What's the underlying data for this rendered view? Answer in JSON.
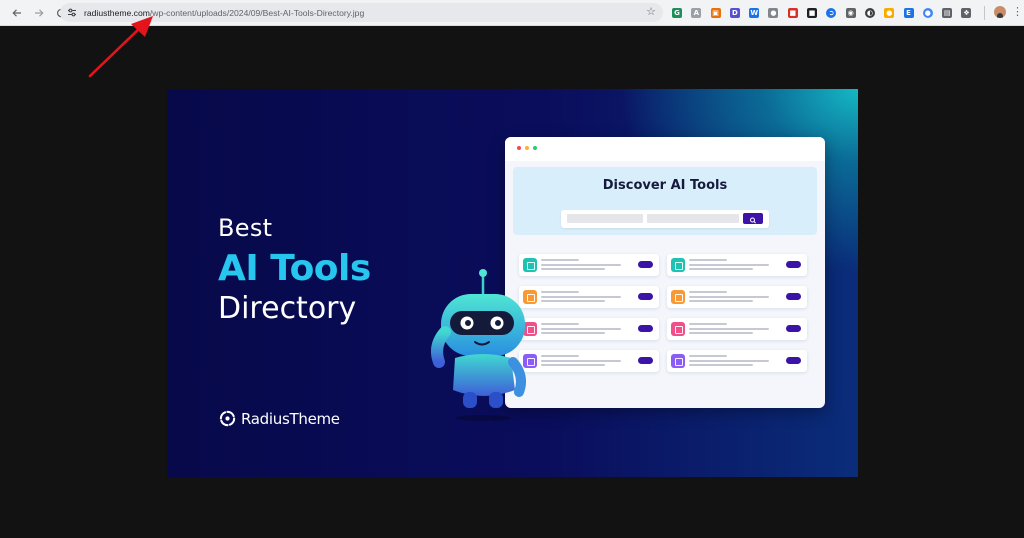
{
  "browser": {
    "nav": {
      "back_icon": "arrow-left-icon",
      "forward_icon": "arrow-right-icon",
      "reload_icon": "reload-icon"
    },
    "address_bar": {
      "host": "radiustheme.com",
      "path": "/wp-content/uploads/2024/09/Best-AI-Tools-Directory.jpg",
      "site_info_icon": "tune-icon",
      "bookmark_icon": "star-icon"
    },
    "extensions": [
      {
        "icon": "extension-green-icon",
        "color": "#1e8e5a",
        "glyph": "G"
      },
      {
        "icon": "extension-a-icon",
        "color": "#9aa0a6",
        "glyph": "A"
      },
      {
        "icon": "extension-orange-icon",
        "color": "#e8710a",
        "glyph": "▣"
      },
      {
        "icon": "extension-d-icon",
        "color": "#5a4fcf",
        "glyph": "D"
      },
      {
        "icon": "extension-blue-icon",
        "color": "#1a73e8",
        "glyph": "W"
      },
      {
        "icon": "extension-grey-icon",
        "color": "#80868b",
        "glyph": "●"
      },
      {
        "icon": "extension-red-icon",
        "color": "#d93025",
        "glyph": "■"
      },
      {
        "icon": "extension-dark-icon",
        "color": "#202124",
        "glyph": "■"
      },
      {
        "icon": "extension-blue-round-icon",
        "color": "#1a73e8",
        "glyph": "➲"
      },
      {
        "icon": "camera-icon",
        "color": "#5f6368",
        "glyph": "◉"
      },
      {
        "icon": "extension-dark-round-icon",
        "color": "#3c4043",
        "glyph": "◐"
      },
      {
        "icon": "extension-yellow-icon",
        "color": "#f9ab00",
        "glyph": "●"
      },
      {
        "icon": "extension-teal-icon",
        "color": "#1a73e8",
        "glyph": "E"
      },
      {
        "icon": "extension-blue-dot-icon",
        "color": "#4285f4",
        "glyph": "●"
      },
      {
        "icon": "extension-grid-icon",
        "color": "#5f6368",
        "glyph": "▤"
      },
      {
        "icon": "extensions-puzzle-icon",
        "color": "#5f6368",
        "glyph": "❖"
      }
    ],
    "profile_icon": "avatar-icon",
    "menu_icon": "more-vert-icon",
    "menu_glyph": "⋮"
  },
  "annotation": {
    "type": "red-arrow",
    "color": "#e3141b"
  },
  "banner": {
    "headline": {
      "line1": "Best",
      "line2": "AI Tools",
      "line3": "Directory"
    },
    "brand": {
      "name": "RadiusTheme",
      "logo_icon": "radiustheme-logo-icon"
    },
    "colors": {
      "accent": "#27c6ee",
      "background": "#07094a",
      "glow": "#15b8c4",
      "button": "#3d12a8"
    },
    "mock_window": {
      "title": "Discover AI Tools",
      "dots": [
        "#f5455c",
        "#fbb13c",
        "#2ec77a"
      ],
      "cards": [
        {
          "icon_color": "#1fc3b3"
        },
        {
          "icon_color": "#1fc3b3"
        },
        {
          "icon_color": "#f79a35"
        },
        {
          "icon_color": "#f79a35"
        },
        {
          "icon_color": "#f0508a"
        },
        {
          "icon_color": "#f0508a"
        },
        {
          "icon_color": "#8b5cf6"
        },
        {
          "icon_color": "#8b5cf6"
        }
      ]
    },
    "robot_icon": "robot-mascot-icon"
  }
}
